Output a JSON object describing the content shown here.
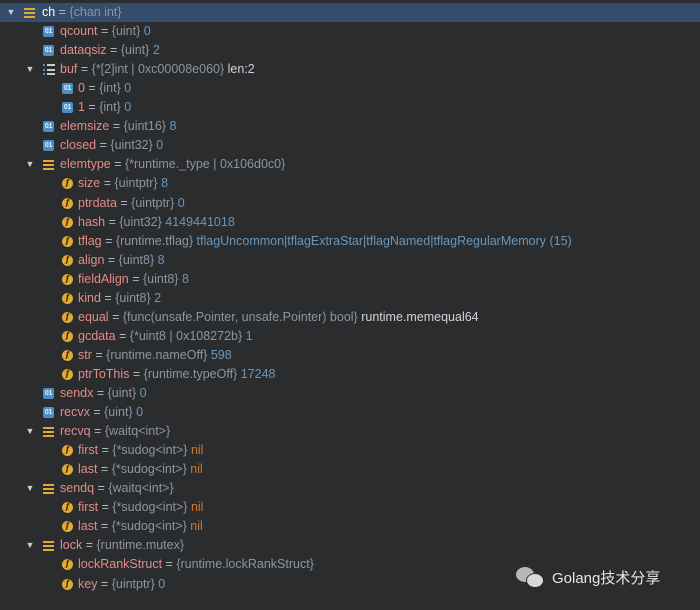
{
  "rows": [
    {
      "depth": 0,
      "expand": "open",
      "icon": "struct",
      "selected": true,
      "name": "ch",
      "type": "{chan int}",
      "value": "",
      "vkind": ""
    },
    {
      "depth": 1,
      "expand": "",
      "icon": "01",
      "name": "qcount",
      "type": "{uint}",
      "value": "0",
      "vkind": "num"
    },
    {
      "depth": 1,
      "expand": "",
      "icon": "01",
      "name": "dataqsiz",
      "type": "{uint}",
      "value": "2",
      "vkind": "num"
    },
    {
      "depth": 1,
      "expand": "open",
      "icon": "array",
      "name": "buf",
      "type": "{*[2]int | 0xc00008e060}",
      "value": "len:2",
      "vkind": "plain"
    },
    {
      "depth": 2,
      "expand": "",
      "icon": "01",
      "name": "0",
      "type": "{int}",
      "value": "0",
      "vkind": "num"
    },
    {
      "depth": 2,
      "expand": "",
      "icon": "01",
      "name": "1",
      "type": "{int}",
      "value": "0",
      "vkind": "num"
    },
    {
      "depth": 1,
      "expand": "",
      "icon": "01",
      "name": "elemsize",
      "type": "{uint16}",
      "value": "8",
      "vkind": "num"
    },
    {
      "depth": 1,
      "expand": "",
      "icon": "01",
      "name": "closed",
      "type": "{uint32}",
      "value": "0",
      "vkind": "num"
    },
    {
      "depth": 1,
      "expand": "open",
      "icon": "struct",
      "name": "elemtype",
      "type": "{*runtime._type | 0x106d0c0}",
      "value": "",
      "vkind": ""
    },
    {
      "depth": 2,
      "expand": "",
      "icon": "f",
      "name": "size",
      "type": "{uintptr}",
      "value": "8",
      "vkind": "num"
    },
    {
      "depth": 2,
      "expand": "",
      "icon": "f",
      "name": "ptrdata",
      "type": "{uintptr}",
      "value": "0",
      "vkind": "num"
    },
    {
      "depth": 2,
      "expand": "",
      "icon": "f",
      "name": "hash",
      "type": "{uint32}",
      "value": "4149441018",
      "vkind": "num"
    },
    {
      "depth": 2,
      "expand": "",
      "icon": "f",
      "name": "tflag",
      "type": "{runtime.tflag}",
      "value": "tflagUncommon|tflagExtraStar|tflagNamed|tflagRegularMemory (15)",
      "vkind": "num"
    },
    {
      "depth": 2,
      "expand": "",
      "icon": "f",
      "name": "align",
      "type": "{uint8}",
      "value": "8",
      "vkind": "num"
    },
    {
      "depth": 2,
      "expand": "",
      "icon": "f",
      "name": "fieldAlign",
      "type": "{uint8}",
      "value": "8",
      "vkind": "num"
    },
    {
      "depth": 2,
      "expand": "",
      "icon": "f",
      "name": "kind",
      "type": "{uint8}",
      "value": "2",
      "vkind": "num"
    },
    {
      "depth": 2,
      "expand": "",
      "icon": "f",
      "name": "equal",
      "type": "{func(unsafe.Pointer, unsafe.Pointer) bool}",
      "value": "runtime.memequal64",
      "vkind": "plain"
    },
    {
      "depth": 2,
      "expand": "",
      "icon": "f",
      "name": "gcdata",
      "type": "{*uint8 | 0x108272b}",
      "value": "1",
      "vkind": "num"
    },
    {
      "depth": 2,
      "expand": "",
      "icon": "f",
      "name": "str",
      "type": "{runtime.nameOff}",
      "value": "598",
      "vkind": "num"
    },
    {
      "depth": 2,
      "expand": "",
      "icon": "f",
      "name": "ptrToThis",
      "type": "{runtime.typeOff}",
      "value": "17248",
      "vkind": "num"
    },
    {
      "depth": 1,
      "expand": "",
      "icon": "01",
      "name": "sendx",
      "type": "{uint}",
      "value": "0",
      "vkind": "num"
    },
    {
      "depth": 1,
      "expand": "",
      "icon": "01",
      "name": "recvx",
      "type": "{uint}",
      "value": "0",
      "vkind": "num"
    },
    {
      "depth": 1,
      "expand": "open",
      "icon": "struct",
      "name": "recvq",
      "type": "{waitq<int>}",
      "value": "",
      "vkind": ""
    },
    {
      "depth": 2,
      "expand": "",
      "icon": "f",
      "name": "first",
      "type": "{*sudog<int>}",
      "value": "nil",
      "vkind": "nil"
    },
    {
      "depth": 2,
      "expand": "",
      "icon": "f",
      "name": "last",
      "type": "{*sudog<int>}",
      "value": "nil",
      "vkind": "nil"
    },
    {
      "depth": 1,
      "expand": "open",
      "icon": "struct",
      "name": "sendq",
      "type": "{waitq<int>}",
      "value": "",
      "vkind": ""
    },
    {
      "depth": 2,
      "expand": "",
      "icon": "f",
      "name": "first",
      "type": "{*sudog<int>}",
      "value": "nil",
      "vkind": "nil"
    },
    {
      "depth": 2,
      "expand": "",
      "icon": "f",
      "name": "last",
      "type": "{*sudog<int>}",
      "value": "nil",
      "vkind": "nil"
    },
    {
      "depth": 1,
      "expand": "open",
      "icon": "struct",
      "name": "lock",
      "type": "{runtime.mutex}",
      "value": "",
      "vkind": ""
    },
    {
      "depth": 2,
      "expand": "",
      "icon": "f",
      "name": "lockRankStruct",
      "type": "{runtime.lockRankStruct}",
      "value": "",
      "vkind": ""
    },
    {
      "depth": 2,
      "expand": "",
      "icon": "f",
      "name": "key",
      "type": "{uintptr}",
      "value": "0",
      "vkind": "num"
    }
  ],
  "equals_sign": "=",
  "icon_labels": {
    "f": "f",
    "01": "01"
  },
  "watermark": {
    "text": "Golang技术分享",
    "icon": "wechat-icon"
  },
  "colors": {
    "background": "#2b2c2e",
    "selection": "#354c6c",
    "name": "#e48b8b",
    "number": "#6897bb",
    "nil": "#cc7832",
    "field_icon": "#e3a935",
    "primitive_icon": "#4a8fc5"
  }
}
